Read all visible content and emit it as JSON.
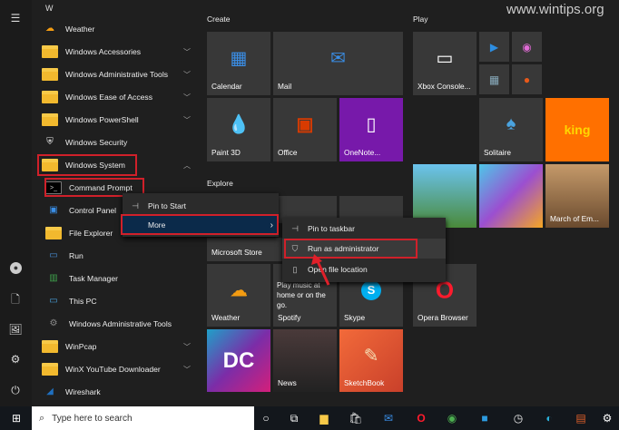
{
  "watermark": "www.wintips.org",
  "letter_header": "W",
  "apps": [
    {
      "label": "Weather",
      "icon": "weather-icon",
      "color": "#f39c12",
      "chevron": false
    },
    {
      "label": "Windows Accessories",
      "icon": "folder-icon",
      "chevron": true
    },
    {
      "label": "Windows Administrative Tools",
      "icon": "folder-icon",
      "chevron": true
    },
    {
      "label": "Windows Ease of Access",
      "icon": "folder-icon",
      "chevron": true
    },
    {
      "label": "Windows PowerShell",
      "icon": "folder-icon",
      "chevron": true
    },
    {
      "label": "Windows Security",
      "icon": "shield-icon",
      "color": "#eeeeee",
      "chevron": false
    },
    {
      "label": "Windows System",
      "icon": "folder-icon",
      "chevron": true,
      "expanded": true
    },
    {
      "label": "Command Prompt",
      "icon": "terminal-icon",
      "color": "#111111",
      "chevron": false,
      "indent": true
    },
    {
      "label": "Control Panel",
      "icon": "control-panel-icon",
      "color": "#3a8ee6",
      "chevron": false,
      "indent": true
    },
    {
      "label": "File Explorer",
      "icon": "folder-icon",
      "chevron": false,
      "indent": true
    },
    {
      "label": "Run",
      "icon": "run-icon",
      "color": "#4a90d9",
      "chevron": false,
      "indent": true
    },
    {
      "label": "Task Manager",
      "icon": "task-manager-icon",
      "color": "#3fa34d",
      "chevron": false,
      "indent": true
    },
    {
      "label": "This PC",
      "icon": "computer-icon",
      "color": "#4aa3df",
      "chevron": false,
      "indent": true
    },
    {
      "label": "Windows Administrative Tools",
      "icon": "admin-tools-icon",
      "color": "#8a8a8a",
      "chevron": false,
      "indent": true
    },
    {
      "label": "WinPcap",
      "icon": "folder-icon",
      "chevron": true
    },
    {
      "label": "WinX YouTube Downloader",
      "icon": "folder-icon",
      "chevron": true
    },
    {
      "label": "Wireshark",
      "icon": "wireshark-icon",
      "color": "#1f6fbf",
      "chevron": false
    }
  ],
  "sections": {
    "create": "Create",
    "play": "Play",
    "explore": "Explore"
  },
  "tiles": {
    "calendar": "Calendar",
    "mail": "Mail",
    "paint3d": "Paint 3D",
    "office": "Office",
    "onenote": "OneNote...",
    "xbox": "Xbox Console...",
    "solitaire": "Solitaire",
    "king": "king",
    "store": "Microsoft Store",
    "weather": "Weather",
    "spotify": "Spotify",
    "spotify_text": "Play music at home or on the go.",
    "skype": "Skype",
    "opera": "Opera Browser",
    "news": "News",
    "sketchbook": "SketchBook",
    "march": "March of Em..."
  },
  "context_menu": {
    "pin_start": "Pin to Start",
    "more": "More"
  },
  "submenu": {
    "pin_taskbar": "Pin to taskbar",
    "run_admin": "Run as administrator",
    "open_location": "Open file location"
  },
  "taskbar": {
    "search_placeholder": "Type here to search"
  }
}
